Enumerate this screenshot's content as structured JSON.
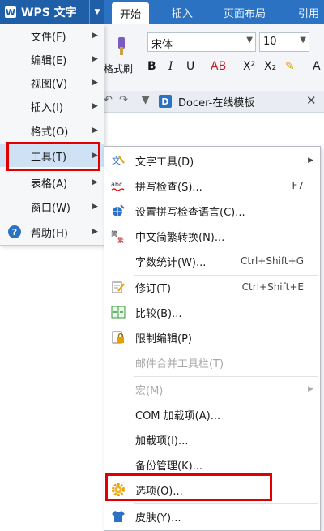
{
  "app": {
    "logo_letter": "W",
    "menu_button": "WPS 文字",
    "tabs": [
      "开始",
      "插入",
      "页面布局",
      "引用"
    ]
  },
  "ribbon": {
    "font_name": "宋体",
    "font_size": "10",
    "format_painter": "格式刷",
    "format_buttons": [
      "B",
      "I",
      "U",
      "AB",
      "X²",
      "X₂",
      "A"
    ],
    "docer_tab": "Docer-在线模板",
    "docer_icon_letter": "D"
  },
  "main_menu": {
    "items": [
      {
        "label": "文件(F)"
      },
      {
        "label": "编辑(E)"
      },
      {
        "label": "视图(V)"
      },
      {
        "label": "插入(I)"
      },
      {
        "label": "格式(O)"
      },
      {
        "label": "工具(T)"
      },
      {
        "label": "表格(A)"
      },
      {
        "label": "窗口(W)"
      },
      {
        "label": "帮助(H)"
      }
    ],
    "active": "工具(T)"
  },
  "tools_menu": {
    "items": [
      {
        "label": "文字工具(D)",
        "shortcut": "",
        "icon": "text-tools-icon",
        "submenu": true,
        "enabled": true
      },
      {
        "label": "拼写检查(S)...",
        "shortcut": "F7",
        "icon": "spell-check-icon",
        "submenu": false,
        "enabled": true
      },
      {
        "label": "设置拼写检查语言(C)...",
        "shortcut": "",
        "icon": "spell-language-icon",
        "submenu": false,
        "enabled": true
      },
      {
        "label": "中文简繁转换(N)...",
        "shortcut": "",
        "icon": "chinese-convert-icon",
        "submenu": false,
        "enabled": true
      },
      {
        "label": "字数统计(W)...",
        "shortcut": "Ctrl+Shift+G",
        "icon": "",
        "submenu": false,
        "enabled": true
      },
      {
        "label": "修订(T)",
        "shortcut": "Ctrl+Shift+E",
        "icon": "revision-icon",
        "submenu": false,
        "enabled": true
      },
      {
        "label": "比较(B)...",
        "shortcut": "",
        "icon": "compare-icon",
        "submenu": false,
        "enabled": true
      },
      {
        "label": "限制编辑(P)",
        "shortcut": "",
        "icon": "restrict-edit-icon",
        "submenu": false,
        "enabled": true
      },
      {
        "label": "邮件合并工具栏(T)",
        "shortcut": "",
        "icon": "",
        "submenu": false,
        "enabled": false
      },
      {
        "label": "宏(M)",
        "shortcut": "",
        "icon": "",
        "submenu": true,
        "enabled": false
      },
      {
        "label": "COM 加载项(A)...",
        "shortcut": "",
        "icon": "",
        "submenu": false,
        "enabled": true
      },
      {
        "label": "加载项(I)...",
        "shortcut": "",
        "icon": "",
        "submenu": false,
        "enabled": true
      },
      {
        "label": "备份管理(K)...",
        "shortcut": "",
        "icon": "",
        "submenu": false,
        "enabled": true
      },
      {
        "label": "选项(O)...",
        "shortcut": "",
        "icon": "options-gear-icon",
        "submenu": false,
        "enabled": true
      },
      {
        "label": "皮肤(Y)...",
        "shortcut": "",
        "icon": "skin-icon",
        "submenu": false,
        "enabled": true
      }
    ]
  },
  "colors": {
    "title_bar": "#2b73c2",
    "highlight_box": "#e00000",
    "active_menu_item": "#cfe1f5",
    "disabled_text": "#a8a8a8"
  }
}
